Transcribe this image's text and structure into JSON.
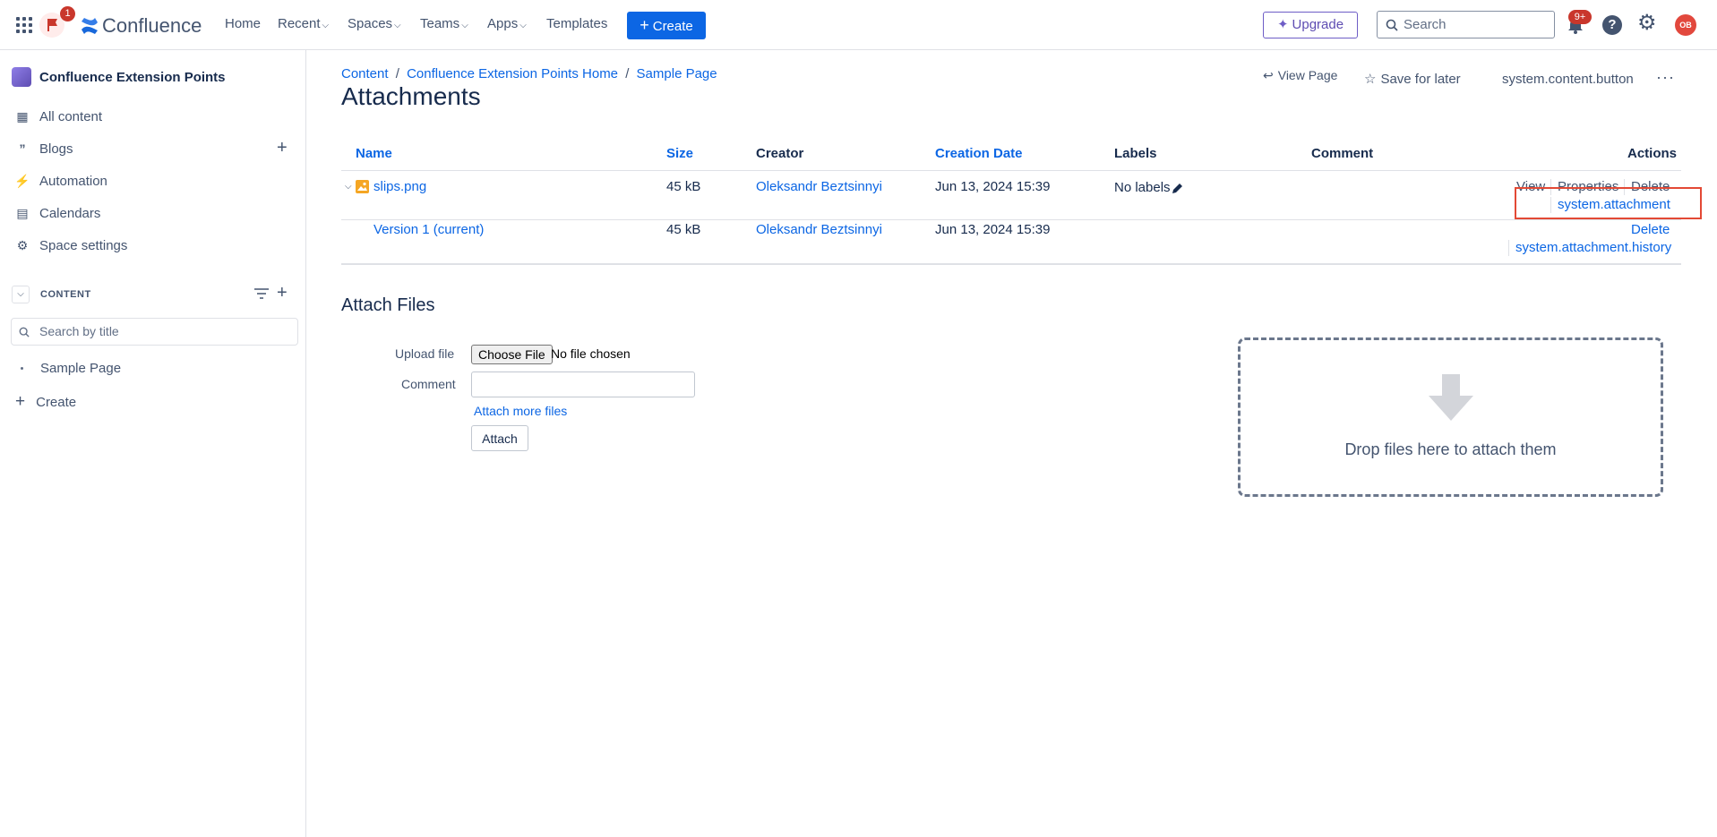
{
  "header": {
    "app_name": "Confluence",
    "notification_count": "1",
    "nav": {
      "home": "Home",
      "recent": "Recent",
      "spaces": "Spaces",
      "teams": "Teams",
      "apps": "Apps",
      "templates": "Templates"
    },
    "create_label": "Create",
    "upgrade_label": "Upgrade",
    "search_placeholder": "Search",
    "bell_badge": "9+",
    "avatar_initials": "OB"
  },
  "sidebar": {
    "space_name": "Confluence Extension Points",
    "items": {
      "all_content": "All content",
      "blogs": "Blogs",
      "automation": "Automation",
      "calendars": "Calendars",
      "space_settings": "Space settings"
    },
    "content_section_label": "CONTENT",
    "search_placeholder": "Search by title",
    "tree_page": "Sample Page",
    "create_label": "Create"
  },
  "breadcrumb": {
    "content": "Content",
    "home": "Confluence Extension Points Home",
    "page": "Sample Page"
  },
  "page_actions": {
    "view_page": "View Page",
    "save_for_later": "Save for later",
    "system_content_button": "system.content.button"
  },
  "page_title": "Attachments",
  "table": {
    "headers": {
      "name": "Name",
      "size": "Size",
      "creator": "Creator",
      "creation_date": "Creation Date",
      "labels": "Labels",
      "comment": "Comment",
      "actions": "Actions"
    },
    "row1": {
      "name": "slips.png",
      "size": "45 kB",
      "creator": "Oleksandr Beztsinnyi",
      "date": "Jun 13, 2024 15:39",
      "labels": "No labels",
      "action_view": "View",
      "action_properties": "Properties",
      "action_delete": "Delete",
      "action_system": "system.attachment"
    },
    "row2": {
      "name": "Version 1 (current)",
      "size": "45 kB",
      "creator": "Oleksandr Beztsinnyi",
      "date": "Jun 13, 2024 15:39",
      "action_delete": "Delete",
      "action_system": "system.attachment.history"
    }
  },
  "attach": {
    "title": "Attach Files",
    "upload_label": "Upload file",
    "choose_file": "Choose File",
    "no_file": "No file chosen",
    "comment_label": "Comment",
    "more_files": "Attach more files",
    "attach_button": "Attach",
    "drop_text": "Drop files here to attach them"
  },
  "colors": {
    "primary": "#0c66e4",
    "upgrade": "#6e5dc6",
    "highlight_box": "#e34935",
    "badge": "#c9372c"
  }
}
